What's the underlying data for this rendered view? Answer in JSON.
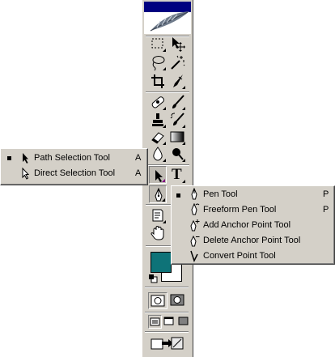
{
  "toolbox": {
    "title_icon": "feather-logo-icon",
    "tools": [
      {
        "id": "marquee",
        "icon": "rect-marquee-icon"
      },
      {
        "id": "move",
        "icon": "move-icon"
      },
      {
        "id": "lasso",
        "icon": "lasso-icon"
      },
      {
        "id": "magic-wand",
        "icon": "magic-wand-icon"
      },
      {
        "id": "crop",
        "icon": "crop-icon"
      },
      {
        "id": "slice",
        "icon": "slice-icon"
      },
      {
        "id": "healing",
        "icon": "healing-brush-icon"
      },
      {
        "id": "brush",
        "icon": "brush-icon"
      },
      {
        "id": "stamp",
        "icon": "clone-stamp-icon"
      },
      {
        "id": "history-brush",
        "icon": "history-brush-icon"
      },
      {
        "id": "eraser",
        "icon": "eraser-icon"
      },
      {
        "id": "gradient",
        "icon": "gradient-icon"
      },
      {
        "id": "blur",
        "icon": "blur-icon"
      },
      {
        "id": "dodge",
        "icon": "dodge-icon"
      },
      {
        "id": "path-selection",
        "icon": "path-selection-icon"
      },
      {
        "id": "type",
        "icon": "type-icon",
        "label": "T"
      },
      {
        "id": "pen",
        "icon": "pen-icon"
      },
      {
        "id": "notes",
        "icon": "notes-icon"
      },
      {
        "id": "hand",
        "icon": "hand-icon"
      },
      {
        "id": "zoom",
        "icon": "zoom-icon"
      }
    ],
    "colors": {
      "foreground": "#0e7378",
      "background": "#ffffff"
    }
  },
  "selection_menu": {
    "items": [
      {
        "label": "Path Selection Tool",
        "shortcut": "A",
        "checked": true
      },
      {
        "label": "Direct Selection Tool",
        "shortcut": "A",
        "checked": false
      }
    ]
  },
  "pen_menu": {
    "items": [
      {
        "label": "Pen Tool",
        "shortcut": "P",
        "checked": true
      },
      {
        "label": "Freeform Pen Tool",
        "shortcut": "P",
        "checked": false
      },
      {
        "label": "Add Anchor Point Tool",
        "shortcut": "",
        "checked": false
      },
      {
        "label": "Delete Anchor Point Tool",
        "shortcut": "",
        "checked": false
      },
      {
        "label": "Convert Point Tool",
        "shortcut": "",
        "checked": false
      }
    ]
  }
}
